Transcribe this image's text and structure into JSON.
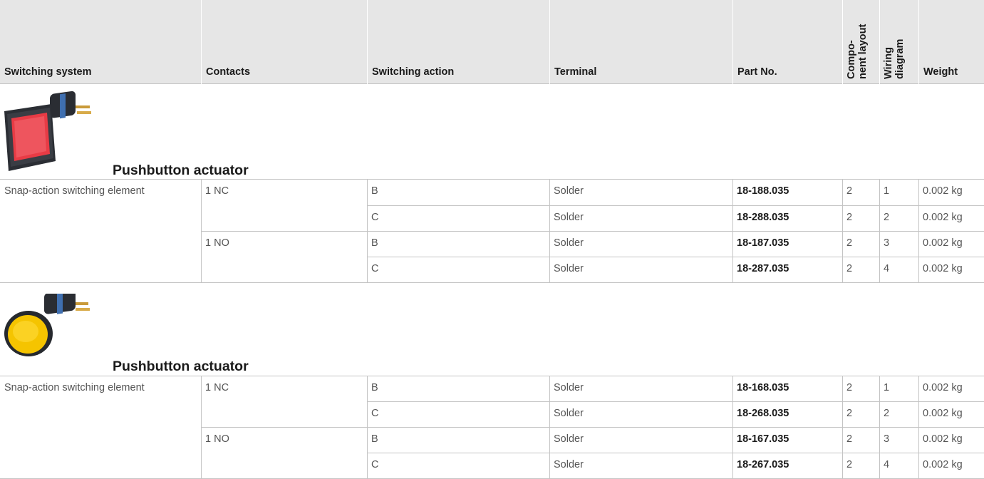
{
  "columns": [
    {
      "label": "Switching system"
    },
    {
      "label": "Contacts"
    },
    {
      "label": "Switching action"
    },
    {
      "label": "Terminal"
    },
    {
      "label": "Part No."
    },
    {
      "label_lines": [
        "Compo-",
        "nent layout"
      ]
    },
    {
      "label_lines": [
        "Wiring",
        "diagram"
      ]
    },
    {
      "label": "Weight"
    }
  ],
  "sections": [
    {
      "title": "Pushbutton actuator",
      "icon": "square-red-pushbutton-icon",
      "icon_color": "#e83b45",
      "switching_system": "Snap-action switching element",
      "contact_groups": [
        {
          "contacts": "1 NC",
          "rows": [
            {
              "action": "B",
              "terminal": "Solder",
              "part_no": "18-188.035",
              "layout": "2",
              "wiring": "1",
              "weight": "0.002 kg"
            },
            {
              "action": "C",
              "terminal": "Solder",
              "part_no": "18-288.035",
              "layout": "2",
              "wiring": "2",
              "weight": "0.002 kg"
            }
          ]
        },
        {
          "contacts": "1 NO",
          "rows": [
            {
              "action": "B",
              "terminal": "Solder",
              "part_no": "18-187.035",
              "layout": "2",
              "wiring": "3",
              "weight": "0.002 kg"
            },
            {
              "action": "C",
              "terminal": "Solder",
              "part_no": "18-287.035",
              "layout": "2",
              "wiring": "4",
              "weight": "0.002 kg"
            }
          ]
        }
      ]
    },
    {
      "title": "Pushbutton actuator",
      "icon": "round-yellow-pushbutton-icon",
      "icon_color": "#f5c400",
      "switching_system": "Snap-action switching element",
      "contact_groups": [
        {
          "contacts": "1 NC",
          "rows": [
            {
              "action": "B",
              "terminal": "Solder",
              "part_no": "18-168.035",
              "layout": "2",
              "wiring": "1",
              "weight": "0.002 kg"
            },
            {
              "action": "C",
              "terminal": "Solder",
              "part_no": "18-268.035",
              "layout": "2",
              "wiring": "2",
              "weight": "0.002 kg"
            }
          ]
        },
        {
          "contacts": "1 NO",
          "rows": [
            {
              "action": "B",
              "terminal": "Solder",
              "part_no": "18-167.035",
              "layout": "2",
              "wiring": "3",
              "weight": "0.002 kg"
            },
            {
              "action": "C",
              "terminal": "Solder",
              "part_no": "18-267.035",
              "layout": "2",
              "wiring": "4",
              "weight": "0.002 kg"
            }
          ]
        }
      ]
    }
  ]
}
